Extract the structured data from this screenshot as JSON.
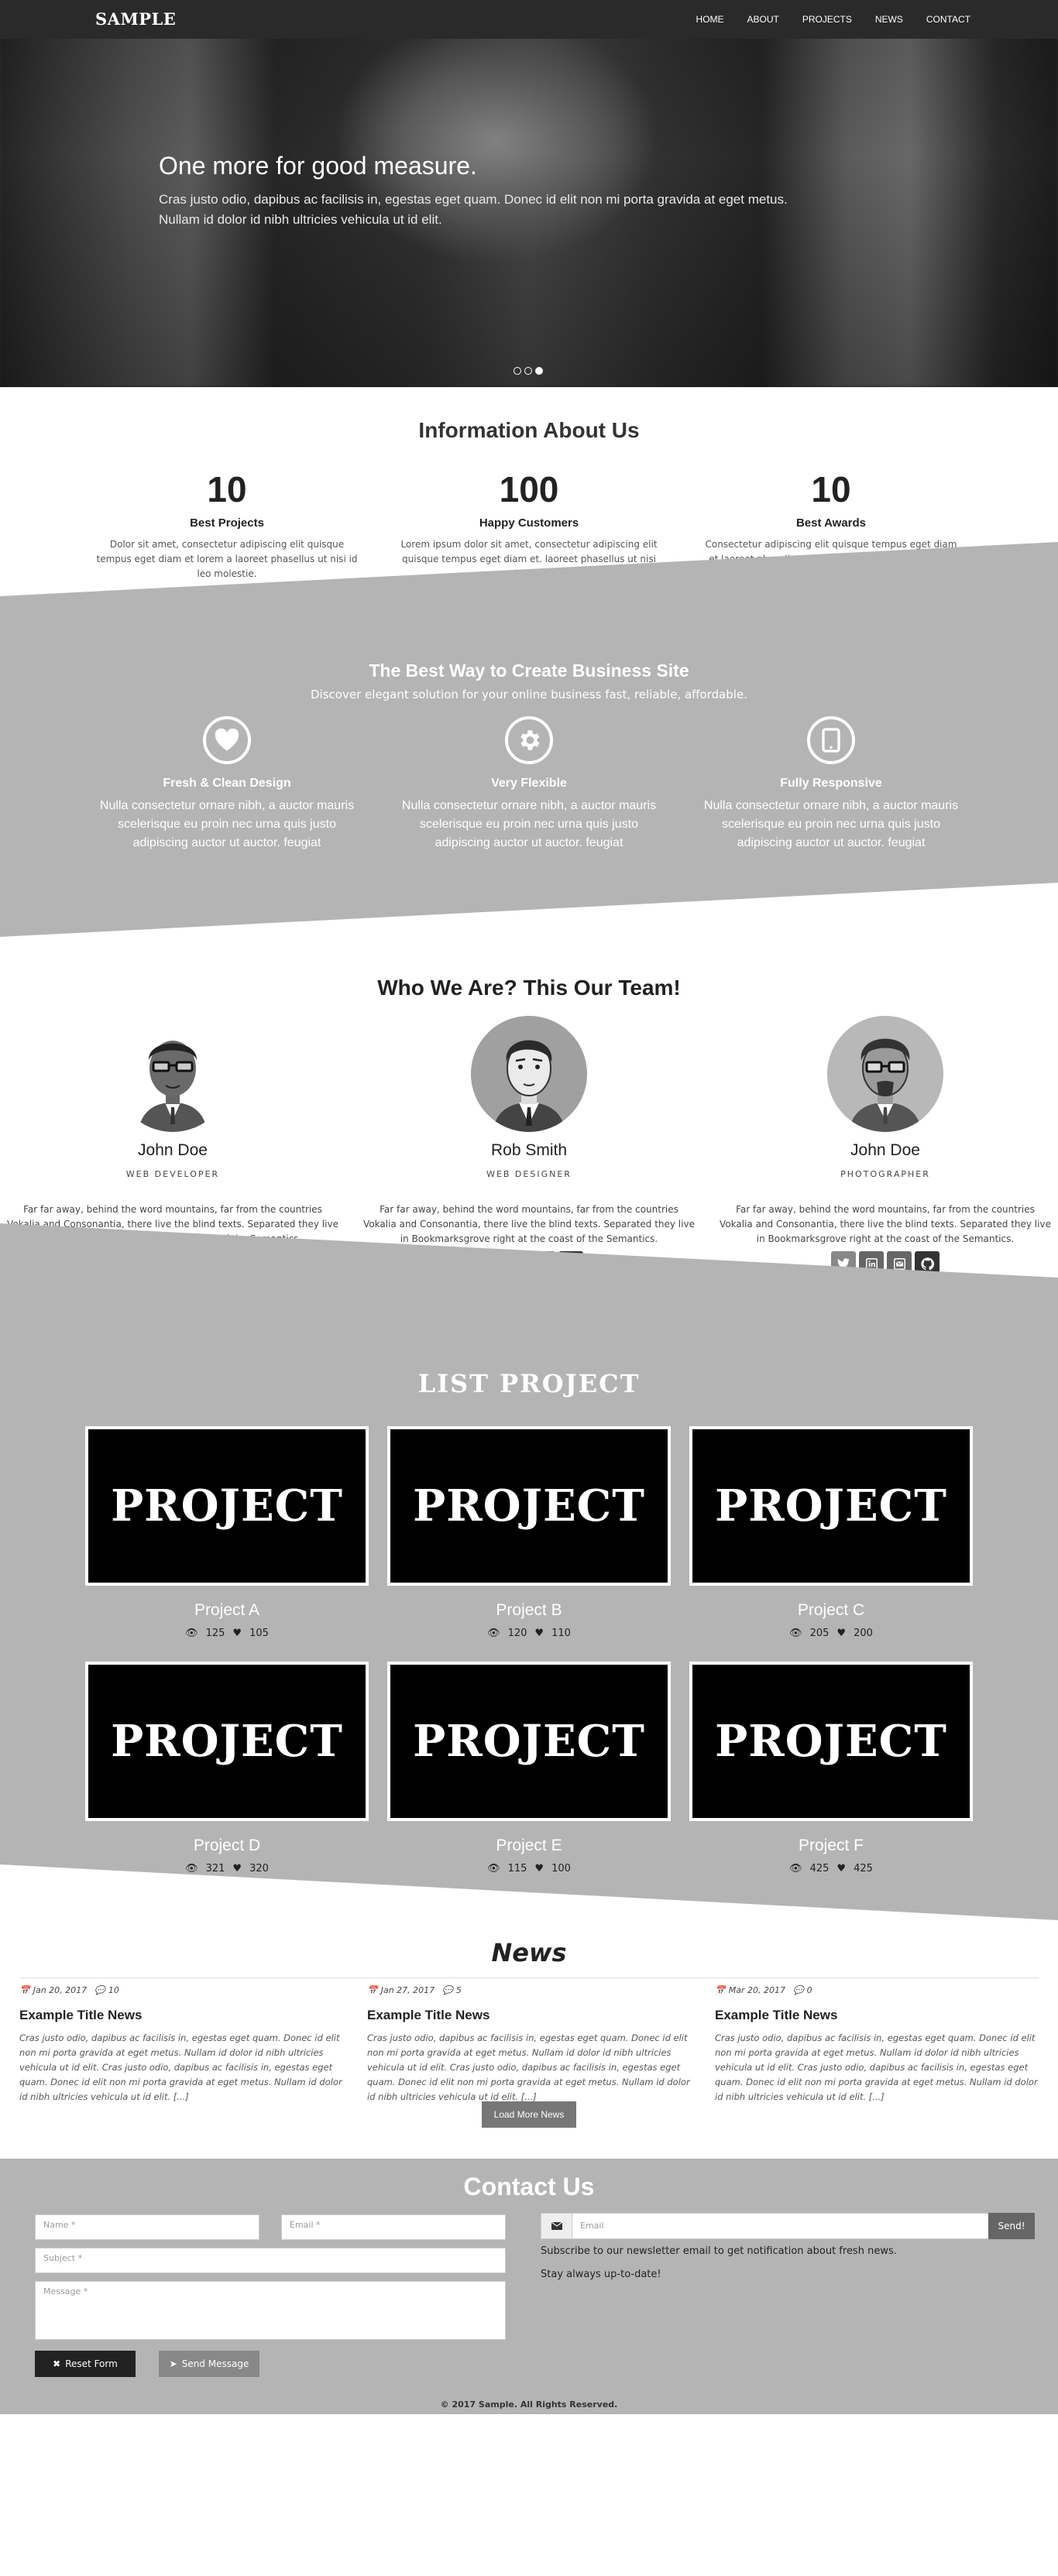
{
  "navbar": {
    "brand": "SAMPLE",
    "items": [
      "HOME",
      "ABOUT",
      "PROJECTS",
      "NEWS",
      "CONTACT"
    ]
  },
  "hero": {
    "title": "One more for good measure.",
    "text": "Cras justo odio, dapibus ac facilisis in, egestas eget quam. Donec id elit non mi porta gravida at eget metus. Nullam id dolor id nibh ultricies vehicula ut id elit.",
    "slides": 3,
    "active_slide": 3
  },
  "info": {
    "title": "Information About Us",
    "stats": [
      {
        "number": "10",
        "label": "Best Projects",
        "text": "Dolor sit amet, consectetur adipiscing elit quisque tempus eget diam et lorem a laoreet phasellus ut nisi id leo molestie."
      },
      {
        "number": "100",
        "label": "Happy Customers",
        "text": "Lorem ipsum dolor sit amet, consectetur adipiscing elit quisque tempus eget diam et. laoreet phasellus ut nisi id leo."
      },
      {
        "number": "10",
        "label": "Best Awards",
        "text": "Consectetur adipiscing elit quisque tempus eget diam et laoreet phasellus ut nisi id leo molestie adipiscing vitae a vel."
      }
    ]
  },
  "business": {
    "title": "The Best Way to Create Business Site",
    "subtitle": "Discover elegant solution for your online business fast, reliable, affordable.",
    "features": [
      {
        "icon": "heart-icon",
        "title": "Fresh & Clean Design",
        "text": "Nulla consectetur ornare nibh, a auctor mauris scelerisque eu proin nec urna quis justo adipiscing auctor ut auctor. feugiat"
      },
      {
        "icon": "gear-icon",
        "title": "Very Flexible",
        "text": "Nulla consectetur ornare nibh, a auctor mauris scelerisque eu proin nec urna quis justo adipiscing auctor ut auctor. feugiat"
      },
      {
        "icon": "tablet-icon",
        "title": "Fully Responsive",
        "text": "Nulla consectetur ornare nibh, a auctor mauris scelerisque eu proin nec urna quis justo adipiscing auctor ut auctor. feugiat"
      }
    ]
  },
  "team": {
    "title": "Who We Are? This Our Team!",
    "members": [
      {
        "name": "John Doe",
        "role": "WEB DEVELOPER",
        "text": "Far far away, behind the word mountains, far from the countries Vokalia and Consonantia, there live the blind texts. Separated they live in Bookmarksgrove right at the coast of the Semantics."
      },
      {
        "name": "Rob Smith",
        "role": "WEB DESIGNER",
        "text": "Far far away, behind the word mountains, far from the countries Vokalia and Consonantia, there live the blind texts. Separated they live in Bookmarksgrove right at the coast of the Semantics."
      },
      {
        "name": "John Doe",
        "role": "PHOTOGRAPHER",
        "text": "Far far away, behind the word mountains, far from the countries Vokalia and Consonantia, there live the blind texts. Separated they live in Bookmarksgrove right at the coast of the Semantics."
      }
    ],
    "social_icons": [
      "twitter-icon",
      "linkedin-icon",
      "envelope-icon",
      "github-icon"
    ]
  },
  "projects": {
    "title": "LIST PROJECT",
    "items": [
      {
        "image_text": "PROJECT",
        "name": "Project A",
        "views": "125",
        "likes": "105"
      },
      {
        "image_text": "PROJECT",
        "name": "Project B",
        "views": "120",
        "likes": "110"
      },
      {
        "image_text": "PROJECT",
        "name": "Project C",
        "views": "205",
        "likes": "200"
      },
      {
        "image_text": "PROJECT",
        "name": "Project D",
        "views": "321",
        "likes": "320"
      },
      {
        "image_text": "PROJECT",
        "name": "Project E",
        "views": "115",
        "likes": "100"
      },
      {
        "image_text": "PROJECT",
        "name": "Project F",
        "views": "425",
        "likes": "425"
      }
    ]
  },
  "news": {
    "title": "News",
    "items": [
      {
        "date": "Jan 20, 2017",
        "comments": "10",
        "title": "Example Title News",
        "body": "Cras justo odio, dapibus ac facilisis in, egestas eget quam. Donec id elit non mi porta gravida at eget metus. Nullam id dolor id nibh ultricies vehicula ut id elit. Cras justo odio, dapibus ac facilisis in, egestas eget quam. Donec id elit non mi porta gravida at eget metus. Nullam id dolor id nibh ultricies vehicula ut id elit. [...]"
      },
      {
        "date": "Jan 27, 2017",
        "comments": "5",
        "title": "Example Title News",
        "body": "Cras justo odio, dapibus ac facilisis in, egestas eget quam. Donec id elit non mi porta gravida at eget metus. Nullam id dolor id nibh ultricies vehicula ut id elit. Cras justo odio, dapibus ac facilisis in, egestas eget quam. Donec id elit non mi porta gravida at eget metus. Nullam id dolor id nibh ultricies vehicula ut id elit. [...]"
      },
      {
        "date": "Mar 20, 2017",
        "comments": "0",
        "title": "Example Title News",
        "body": "Cras justo odio, dapibus ac facilisis in, egestas eget quam. Donec id elit non mi porta gravida at eget metus. Nullam id dolor id nibh ultricies vehicula ut id elit. Cras justo odio, dapibus ac facilisis in, egestas eget quam. Donec id elit non mi porta gravida at eget metus. Nullam id dolor id nibh ultricies vehicula ut id elit. [...]"
      }
    ],
    "more_label": "Load More News"
  },
  "contact": {
    "title": "Contact Us",
    "name_placeholder": "Name *",
    "email_placeholder": "Email *",
    "subject_placeholder": "Subject *",
    "message_placeholder": "Message *",
    "reset_label": "Reset Form",
    "send_label": "Send Message",
    "newsletter_placeholder": "Email",
    "newsletter_button": "Send!",
    "newsletter_text": "Subscribe to our newsletter email to get notification about fresh news.",
    "newsletter_text2": "Stay always up-to-date!"
  },
  "footer": {
    "text": "© 2017 Sample. All Rights Reserved."
  },
  "colors": {
    "accent_gray": "#b4b4b4",
    "navbar": "#2a2a2a",
    "dark_button": "#222222",
    "muted_button": "#777777"
  }
}
